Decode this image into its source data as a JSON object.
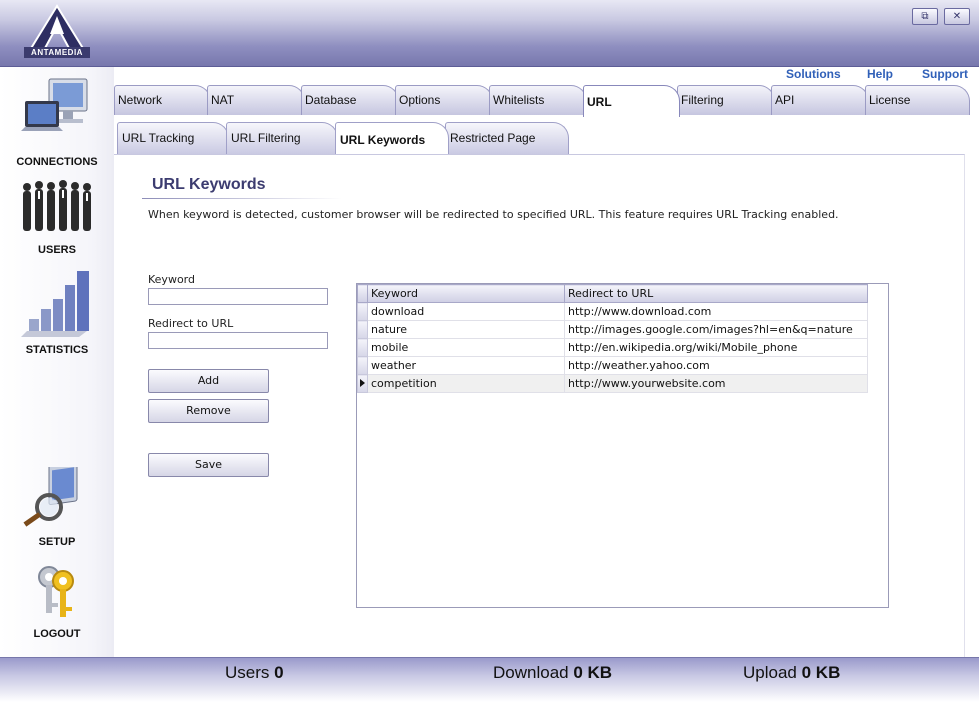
{
  "app": {
    "logo_text": "ANTAMEDIA"
  },
  "window": {
    "restore_icon": "restore-icon",
    "close_icon": "close-icon"
  },
  "header_links": {
    "solutions": "Solutions",
    "help": "Help",
    "support": "Support"
  },
  "sidebar": {
    "items": [
      {
        "label": "CONNECTIONS",
        "icon": "monitor-laptop-icon"
      },
      {
        "label": "USERS",
        "icon": "people-icon"
      },
      {
        "label": "STATISTICS",
        "icon": "bar-chart-icon"
      },
      {
        "label": "SETUP",
        "icon": "magnifier-monitor-icon"
      },
      {
        "label": "LOGOUT",
        "icon": "keys-icon"
      }
    ]
  },
  "tabs": [
    "Network",
    "NAT",
    "Database",
    "Options",
    "Whitelists",
    "URL",
    "Filtering",
    "API",
    "License"
  ],
  "active_tab": "URL",
  "subtabs": [
    "URL Tracking",
    "URL Filtering",
    "URL Keywords",
    "Restricted Page"
  ],
  "active_subtab": "URL Keywords",
  "section": {
    "title": "URL Keywords",
    "description": "When keyword is detected, customer browser will be redirected to specified URL. This feature requires URL Tracking enabled."
  },
  "form": {
    "keyword_label": "Keyword",
    "keyword_value": "",
    "redirect_label": "Redirect to URL",
    "redirect_value": "",
    "add_label": "Add",
    "remove_label": "Remove",
    "save_label": "Save"
  },
  "grid": {
    "columns": [
      "Keyword",
      "Redirect to URL"
    ],
    "rows": [
      [
        "download",
        "http://www.download.com"
      ],
      [
        "nature",
        "http://images.google.com/images?hl=en&q=nature"
      ],
      [
        "mobile",
        "http://en.wikipedia.org/wiki/Mobile_phone"
      ],
      [
        "weather",
        "http://weather.yahoo.com"
      ],
      [
        "competition",
        "http://www.yourwebsite.com"
      ]
    ],
    "current_row": 4
  },
  "footer": {
    "users_label": "Users",
    "users_value": "0",
    "download_label": "Download",
    "download_value": "0 KB",
    "upload_label": "Upload",
    "upload_value": "0 KB"
  }
}
